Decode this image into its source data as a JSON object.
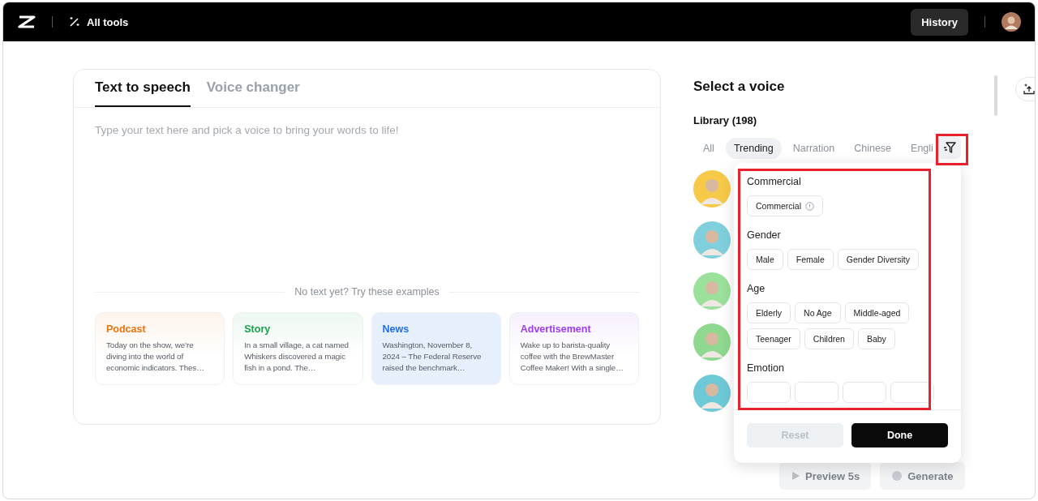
{
  "topbar": {
    "all_tools": "All tools",
    "history": "History"
  },
  "editor": {
    "tabs": [
      {
        "label": "Text to speech",
        "selected": true
      },
      {
        "label": "Voice changer",
        "selected": false
      }
    ],
    "placeholder": "Type your text here and pick a voice to bring your words to life!",
    "examples_hint": "No text yet? Try these examples",
    "examples": [
      {
        "title": "Podcast",
        "color": "#e8740c",
        "text": "Today on the show, we’re diving into the world of economic indicators. Thes…"
      },
      {
        "title": "Story",
        "color": "#16a34a",
        "text": "In a small village, a cat named Whiskers discovered a magic fish in a pond. The…"
      },
      {
        "title": "News",
        "color": "#1e6ff0",
        "text": "Washington, November 8, 2024 – The Federal Reserve raised the benchmark…"
      },
      {
        "title": "Advertisement",
        "color": "#9b3cf0",
        "text": "Wake up to barista-quality coffee with the BrewMaster Coffee Maker! With a single…"
      }
    ]
  },
  "voice_panel": {
    "title": "Select a voice",
    "library": "Library (198)",
    "categories": [
      {
        "label": "All",
        "selected": false
      },
      {
        "label": "Trending",
        "selected": true
      },
      {
        "label": "Narration",
        "selected": false
      },
      {
        "label": "Chinese",
        "selected": false
      },
      {
        "label": "Engli",
        "selected": false
      }
    ],
    "avatars": [
      {
        "color": "#f7c948"
      },
      {
        "color": "#7fd0dc"
      },
      {
        "color": "#9be09b"
      },
      {
        "color": "#8fd88f"
      },
      {
        "color": "#6ec9d6"
      }
    ],
    "buttons": [
      {
        "label": "Preview 5s",
        "kind": "play"
      },
      {
        "label": "Generate",
        "kind": "generate"
      }
    ]
  },
  "filter_popup": {
    "sections": [
      {
        "title": "Commercial",
        "options": [
          {
            "label": "Commercial",
            "kind": "info"
          }
        ]
      },
      {
        "title": "Gender",
        "options": [
          {
            "label": "Male",
            "kind": "plain"
          },
          {
            "label": "Female",
            "kind": "plain"
          },
          {
            "label": "Gender Diversity",
            "kind": "plain"
          }
        ]
      },
      {
        "title": "Age",
        "options": [
          {
            "label": "Elderly",
            "kind": "plain"
          },
          {
            "label": "No Age",
            "kind": "plain"
          },
          {
            "label": "Middle-aged",
            "kind": "plain"
          },
          {
            "label": "Teenager",
            "kind": "plain"
          },
          {
            "label": "Children",
            "kind": "plain"
          },
          {
            "label": "Baby",
            "kind": "plain"
          }
        ]
      },
      {
        "title": "Emotion",
        "options": [
          {
            "kind": "cut"
          },
          {
            "kind": "cut"
          },
          {
            "kind": "cut"
          },
          {
            "kind": "cut"
          }
        ]
      }
    ],
    "reset": {
      "label": "Reset",
      "disabled": true
    },
    "done": {
      "label": "Done"
    }
  }
}
